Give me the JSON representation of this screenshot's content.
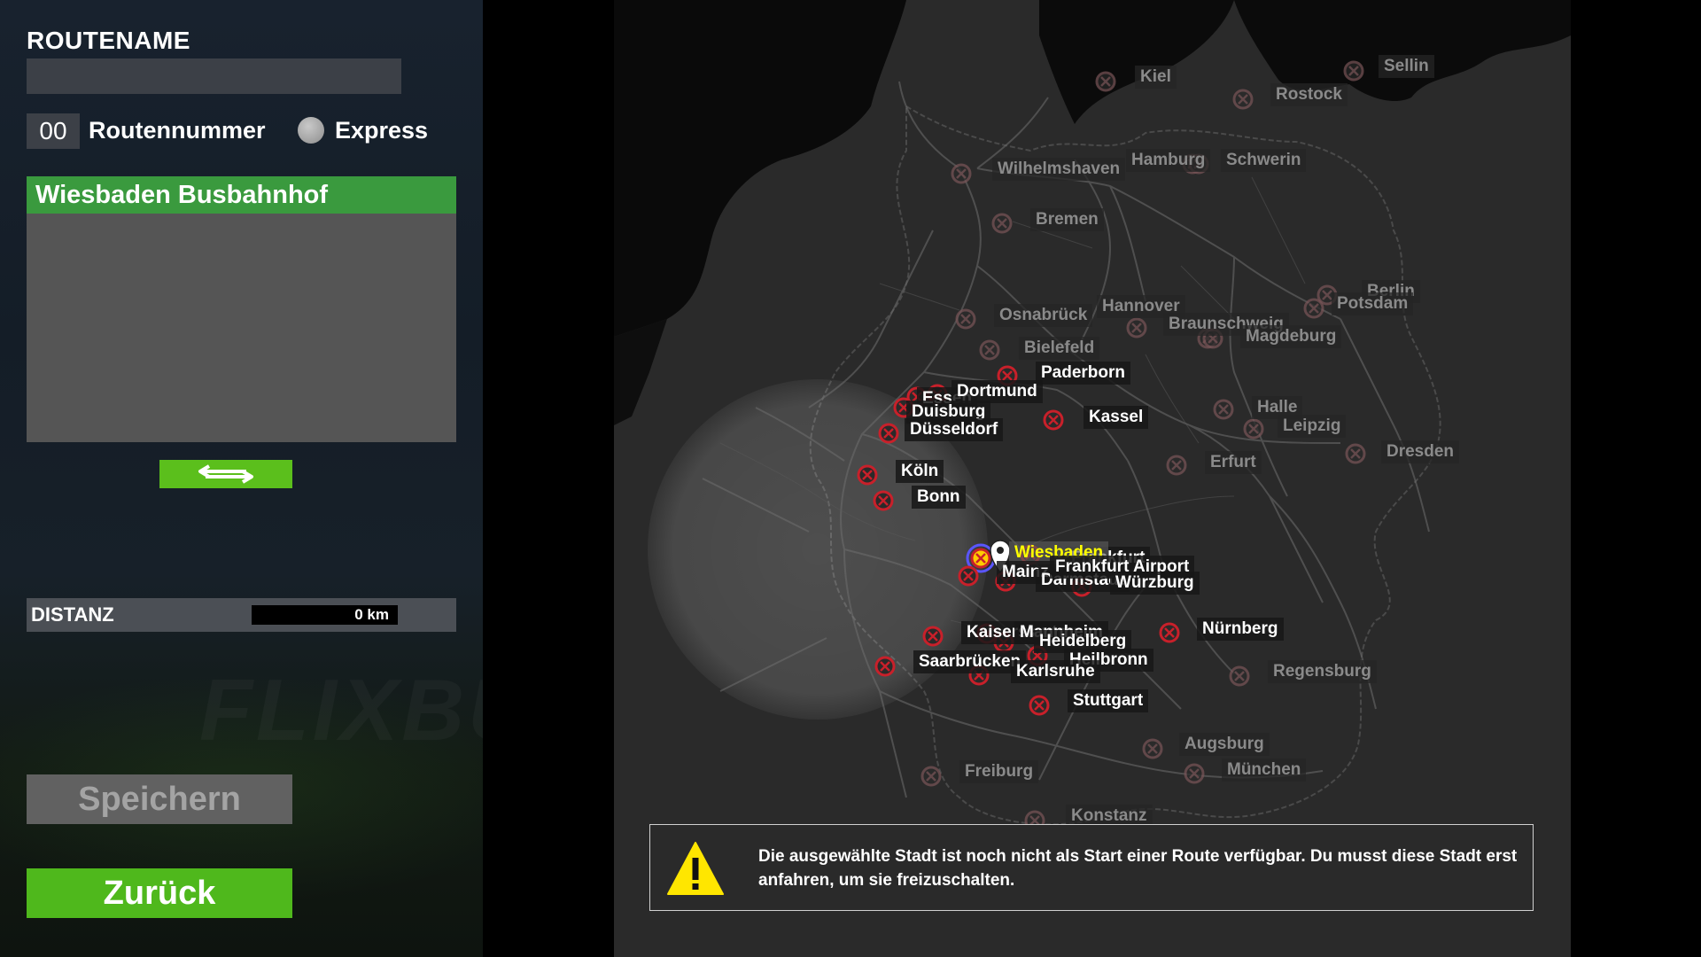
{
  "route": {
    "name_label": "ROUTENAME",
    "name_value": "",
    "number_value": "00",
    "number_label": "Routennummer",
    "express_label": "Express"
  },
  "stops": [
    {
      "label": "Wiesbaden Busbahnhof"
    }
  ],
  "distance": {
    "label": "DISTANZ",
    "value": "0 km"
  },
  "buttons": {
    "save": "Speichern",
    "back": "Zurück"
  },
  "background": {
    "watermark": "FLIXBUS"
  },
  "colors": {
    "accent_green": "#5bbf1c",
    "stop_green": "#3a9a3e",
    "marker_red": "#c8202a",
    "selected_yellow": "#ffff00"
  },
  "map": {
    "cities": [
      {
        "name": "Kiel",
        "active": false
      },
      {
        "name": "Sellin",
        "active": false
      },
      {
        "name": "Rostock",
        "active": false
      },
      {
        "name": "Wilhelmshaven",
        "active": false
      },
      {
        "name": "Hamburg",
        "active": false
      },
      {
        "name": "Schwerin",
        "active": false
      },
      {
        "name": "Bremen",
        "active": false
      },
      {
        "name": "Osnabrück",
        "active": false
      },
      {
        "name": "Hannover",
        "active": false
      },
      {
        "name": "Braunschweig",
        "active": false
      },
      {
        "name": "Berlin",
        "active": false
      },
      {
        "name": "Potsdam",
        "active": false
      },
      {
        "name": "Magdeburg",
        "active": false
      },
      {
        "name": "Bielefeld",
        "active": false
      },
      {
        "name": "Paderborn",
        "active": true
      },
      {
        "name": "Essen",
        "active": true
      },
      {
        "name": "Dortmund",
        "active": true
      },
      {
        "name": "Duisburg",
        "active": true
      },
      {
        "name": "Düsseldorf",
        "active": true
      },
      {
        "name": "Kassel",
        "active": true
      },
      {
        "name": "Halle",
        "active": false
      },
      {
        "name": "Leipzig",
        "active": false
      },
      {
        "name": "Dresden",
        "active": false
      },
      {
        "name": "Erfurt",
        "active": false
      },
      {
        "name": "Köln",
        "active": true
      },
      {
        "name": "Bonn",
        "active": true
      },
      {
        "name": "Frankfurt",
        "active": true
      },
      {
        "name": "Wiesbaden",
        "active": true,
        "selected": true
      },
      {
        "name": "Mainz",
        "active": true
      },
      {
        "name": "Darmstadt",
        "active": true
      },
      {
        "name": "Frankfurt Airport",
        "active": true
      },
      {
        "name": "Würzburg",
        "active": true
      },
      {
        "name": "Nürnberg",
        "active": true
      },
      {
        "name": "Kaiserslautern",
        "active": true
      },
      {
        "name": "Mannheim",
        "active": true
      },
      {
        "name": "Heidelberg",
        "active": true
      },
      {
        "name": "Saarbrücken",
        "active": true
      },
      {
        "name": "Heilbronn",
        "active": true
      },
      {
        "name": "Karlsruhe",
        "active": true
      },
      {
        "name": "Regensburg",
        "active": false
      },
      {
        "name": "Stuttgart",
        "active": true
      },
      {
        "name": "Augsburg",
        "active": false
      },
      {
        "name": "Freiburg",
        "active": false
      },
      {
        "name": "München",
        "active": false
      },
      {
        "name": "Konstanz",
        "active": false
      }
    ]
  },
  "warning": {
    "icon": "warning-triangle-icon",
    "text": "Die ausgewählte Stadt ist noch nicht als Start einer Route verfügbar. Du musst diese Stadt erst anfahren, um sie freizuschalten."
  }
}
